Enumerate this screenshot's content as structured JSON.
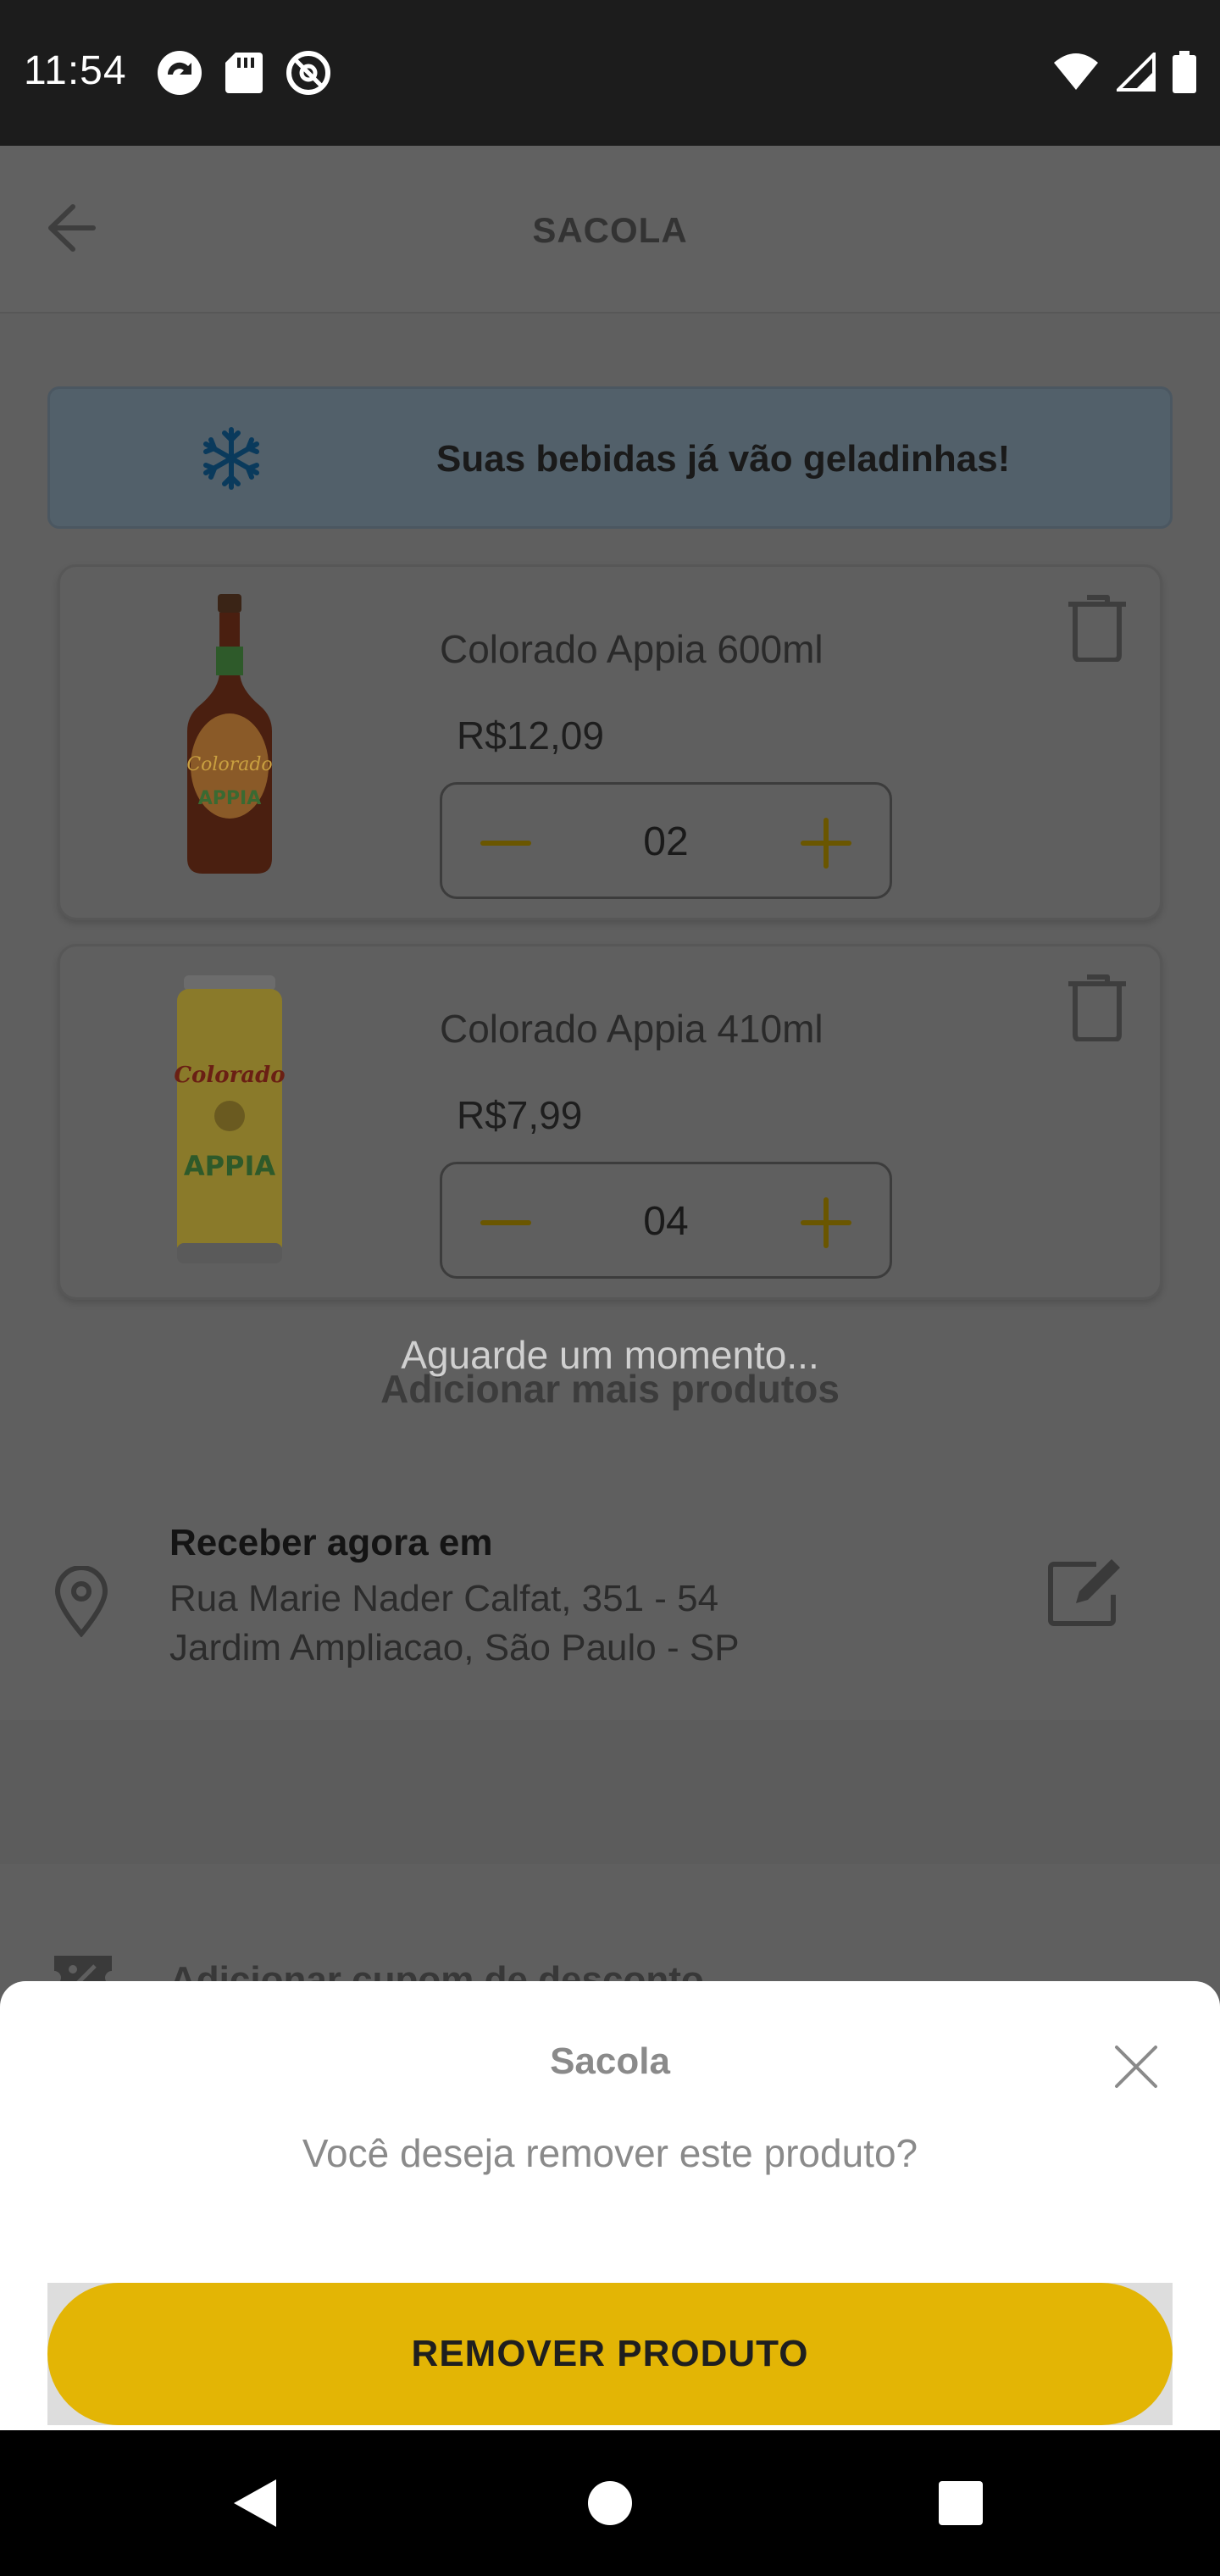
{
  "status_bar": {
    "time": "11:54"
  },
  "header": {
    "title": "SACOLA"
  },
  "banner": {
    "text": "Suas bebidas já vão geladinhas!"
  },
  "cart": {
    "items": [
      {
        "name": "Colorado Appia 600ml",
        "price": "R$12,09",
        "quantity": "02"
      },
      {
        "name": "Colorado Appia 410ml",
        "price": "R$7,99",
        "quantity": "04"
      }
    ]
  },
  "loading_text": "Aguarde um momento...",
  "add_more_label": "Adicionar mais produtos",
  "delivery": {
    "title": "Receber agora em",
    "line1": "Rua Marie Nader Calfat, 351 - 54",
    "line2": "Jardim Ampliacao, São Paulo - SP"
  },
  "coupon_label": "Adicionar cupom de desconto",
  "dialog": {
    "title": "Sacola",
    "message": "Você deseja remover este produto?",
    "confirm_label": "REMOVER PRODUTO"
  },
  "colors": {
    "accent": "#e3b505",
    "overlay": "#5f5f5f"
  },
  "icons": [
    "back-arrow-icon",
    "snowflake-icon",
    "trash-icon",
    "minus-icon",
    "plus-icon",
    "map-pin-icon",
    "edit-icon",
    "coupon-icon",
    "close-icon"
  ]
}
